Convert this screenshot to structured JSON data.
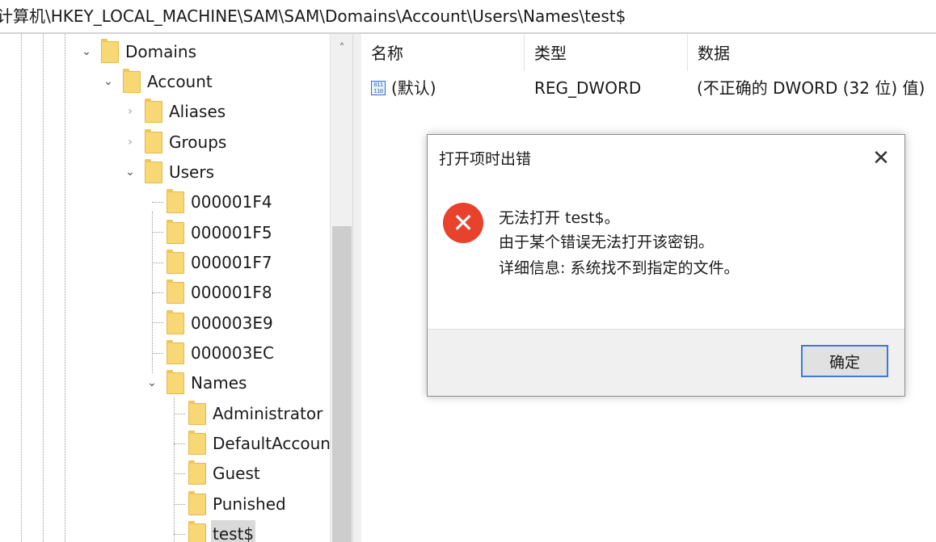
{
  "address_bar": {
    "path": "计算机\\HKEY_LOCAL_MACHINE\\SAM\\SAM\\Domains\\Account\\Users\\Names\\test$"
  },
  "tree": {
    "items": [
      {
        "label": "Domains",
        "state": "expanded"
      },
      {
        "label": "Account",
        "state": "expanded"
      },
      {
        "label": "Aliases",
        "state": "collapsed"
      },
      {
        "label": "Groups",
        "state": "collapsed"
      },
      {
        "label": "Users",
        "state": "expanded"
      },
      {
        "label": "000001F4",
        "state": "leaf"
      },
      {
        "label": "000001F5",
        "state": "leaf"
      },
      {
        "label": "000001F7",
        "state": "leaf"
      },
      {
        "label": "000001F8",
        "state": "leaf"
      },
      {
        "label": "000003E9",
        "state": "leaf"
      },
      {
        "label": "000003EC",
        "state": "leaf"
      },
      {
        "label": "Names",
        "state": "expanded"
      },
      {
        "label": "Administrator",
        "state": "leaf"
      },
      {
        "label": "DefaultAccount",
        "state": "leaf"
      },
      {
        "label": "Guest",
        "state": "leaf"
      },
      {
        "label": "Punished",
        "state": "leaf"
      },
      {
        "label": "test$",
        "state": "selected"
      }
    ]
  },
  "list": {
    "columns": {
      "name": "名称",
      "type": "类型",
      "data": "数据"
    },
    "rows": [
      {
        "icon": "reg-binary-icon",
        "name": "(默认)",
        "type": "REG_DWORD",
        "data": "(不正确的 DWORD (32 位) 值)"
      }
    ]
  },
  "dialog": {
    "title": "打开项时出错",
    "icon": "error-icon",
    "lines": [
      "无法打开 test$。",
      "由于某个错误无法打开该密钥。",
      "详细信息: 系统找不到指定的文件。"
    ],
    "ok_label": "确定"
  },
  "colors": {
    "folder": "#f8d775",
    "error": "#e8412c",
    "button_focus": "#3d7ad8",
    "selection": "#d9d9d9"
  }
}
